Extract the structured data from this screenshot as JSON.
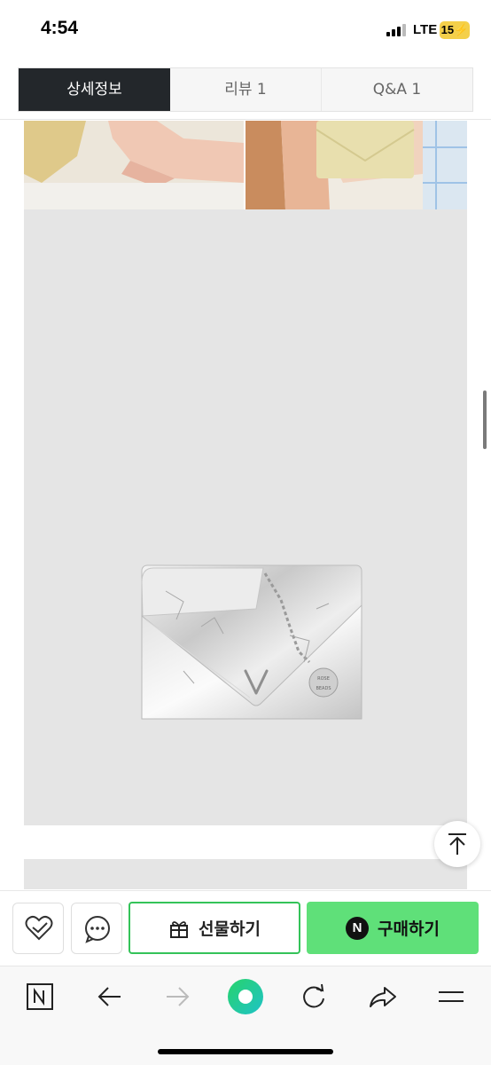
{
  "status_bar": {
    "time": "4:54",
    "network": "LTE",
    "battery": "15"
  },
  "tabs": [
    {
      "label": "상세정보",
      "active": true
    },
    {
      "label": "리뷰 1",
      "active": false
    },
    {
      "label": "Q&A 1",
      "active": false
    }
  ],
  "content": {
    "product_medallion_lines": [
      "ROSE",
      "BEADS"
    ]
  },
  "actions": {
    "like_icon": "heart-check-icon",
    "talk_icon": "chat-bubble-icon",
    "gift_label": "선물하기",
    "gift_icon": "gift-icon",
    "buy_badge": "N",
    "buy_label": "구매하기"
  },
  "browser_nav": {
    "icons": [
      "naver-n-icon",
      "back-arrow-icon",
      "forward-arrow-icon",
      "green-circle-icon",
      "reload-icon",
      "share-icon",
      "menu-icon"
    ]
  },
  "colors": {
    "active_tab": "#23272b",
    "accent_green": "#34c359",
    "buy_button": "#5fe079"
  }
}
